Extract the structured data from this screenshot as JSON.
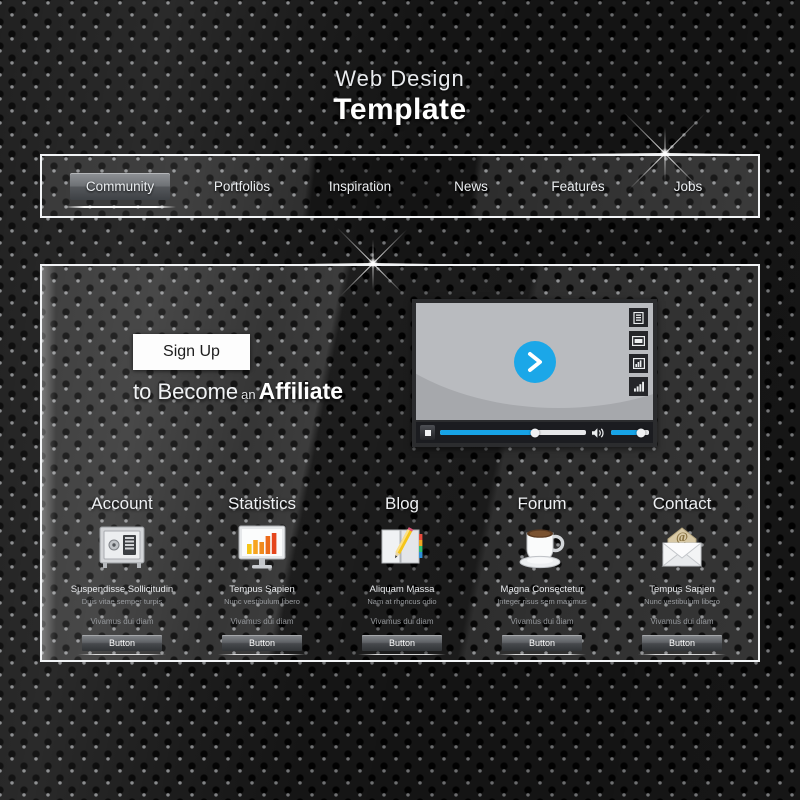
{
  "colors": {
    "accent_blue": "#17a3e6",
    "panel_border": "#f2f4f6",
    "background_dark": "#191919",
    "text_light": "#eef0f3",
    "text_muted": "#94979b"
  },
  "header": {
    "title_line1": "Web Design",
    "title_line2": "Template"
  },
  "nav": {
    "items": [
      {
        "label": "Community",
        "active": true
      },
      {
        "label": "Portfolios",
        "active": false
      },
      {
        "label": "Inspiration",
        "active": false
      },
      {
        "label": "News",
        "active": false
      },
      {
        "label": "Features",
        "active": false
      },
      {
        "label": "Jobs",
        "active": false
      }
    ]
  },
  "hero": {
    "signup_label": "Sign Up",
    "tagline_part1": "to Become",
    "tagline_part2": "an",
    "tagline_part3": "Affiliate"
  },
  "video": {
    "play_icon": "play-chevron-icon",
    "side_icons": [
      {
        "name": "playlist-icon"
      },
      {
        "name": "hd-badge-icon"
      },
      {
        "name": "image-quality-icon"
      },
      {
        "name": "signal-bars-icon"
      }
    ],
    "stop_icon": "stop-icon",
    "speaker_icon": "speaker-icon",
    "progress_percent": 65,
    "volume_percent": 80
  },
  "cards": [
    {
      "title": "Account",
      "icon": "safe-vault-icon",
      "heading": "Suspendisse Sollicitudin",
      "subheading": "Duis vitae semper turpis",
      "note": "Vivamus dui diam",
      "button_label": "Button"
    },
    {
      "title": "Statistics",
      "icon": "monitor-chart-icon",
      "heading": "Tempus Sapien",
      "subheading": "Nunc vestibulum libero",
      "note": "Vivamus dui diam",
      "button_label": "Button"
    },
    {
      "title": "Blog",
      "icon": "notebook-pencil-icon",
      "heading": "Aliquam Massa",
      "subheading": "Nam at rhoncus odio",
      "note": "Vivamus dui diam",
      "button_label": "Button"
    },
    {
      "title": "Forum",
      "icon": "coffee-cup-icon",
      "heading": "Magna Consectetur",
      "subheading": "Integer risus sem maximus",
      "note": "Vivamus dui diam",
      "button_label": "Button"
    },
    {
      "title": "Contact",
      "icon": "envelope-at-icon",
      "heading": "Tempus Sapien",
      "subheading": "Nunc vestibulum libero",
      "note": "Vivamus dui diam",
      "button_label": "Button"
    }
  ]
}
